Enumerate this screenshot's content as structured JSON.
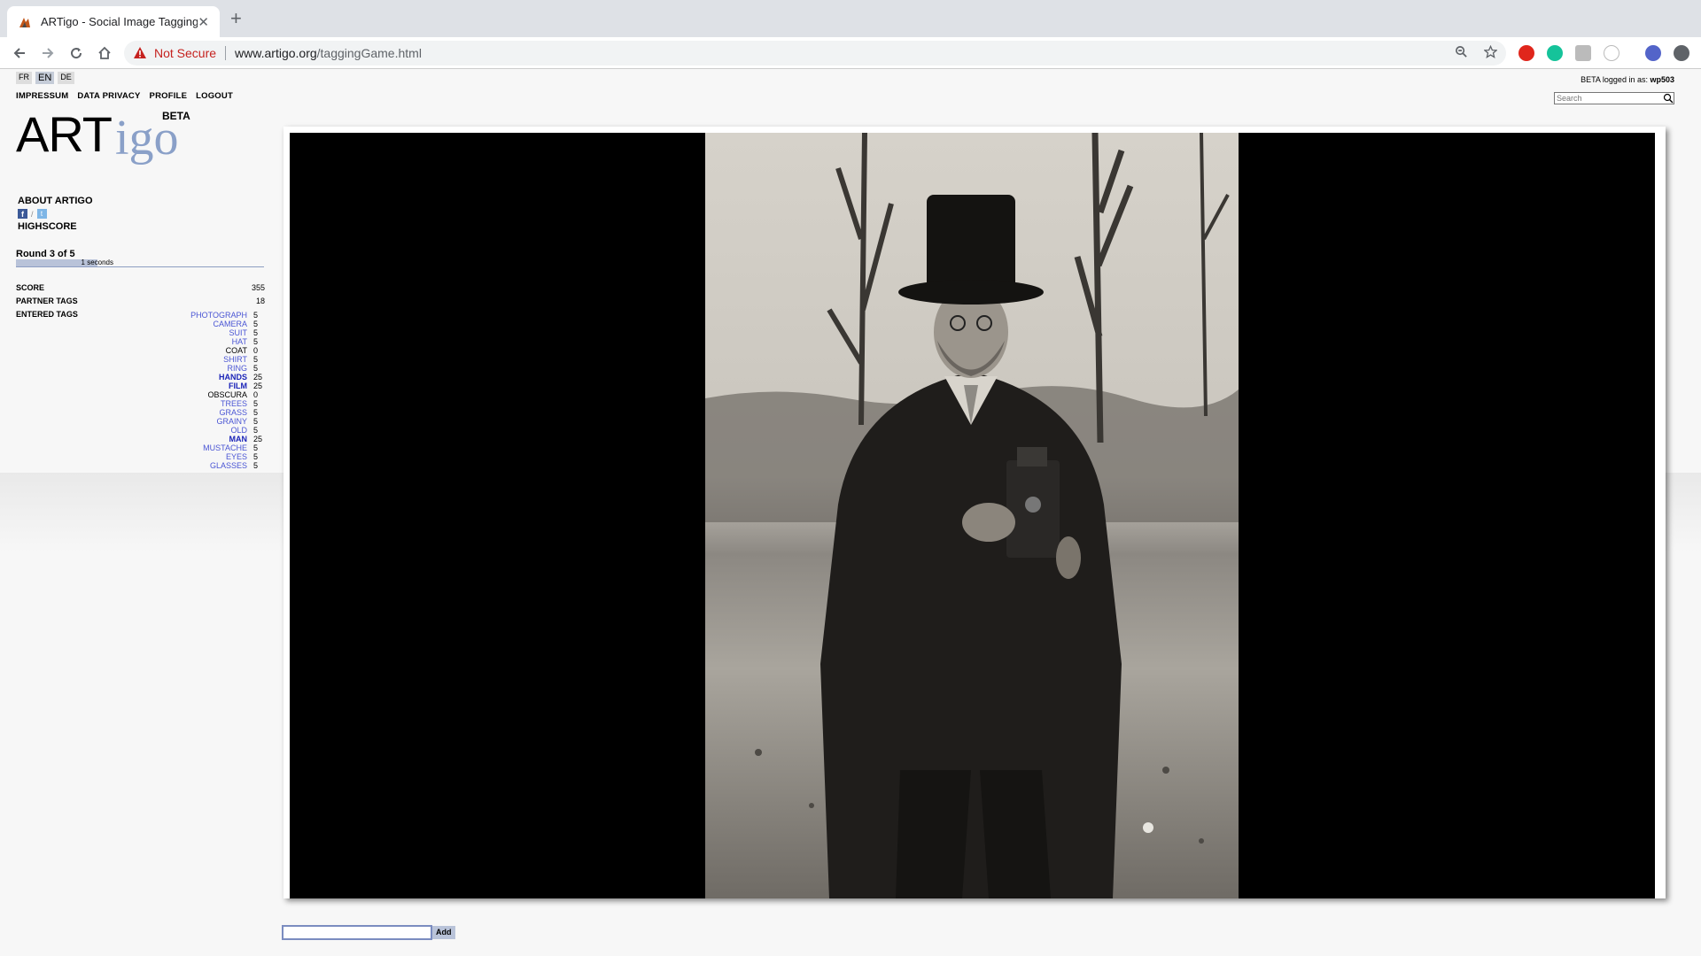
{
  "browser": {
    "tab_title": "ARTigo - Social Image Tagging",
    "new_tab": "+",
    "security_label": "Not Secure",
    "url_host": "www.artigo.org",
    "url_path": "/taggingGame.html"
  },
  "languages": [
    "FR",
    "EN",
    "DE"
  ],
  "active_language": "EN",
  "nav": {
    "impressum": "IMPRESSUM",
    "privacy": "DATA PRIVACY",
    "profile": "PROFILE",
    "logout": "LOGOUT"
  },
  "login": {
    "prefix": "BETA logged in as:",
    "user": "wp503"
  },
  "search": {
    "placeholder": "Search"
  },
  "logo": {
    "art": "ART",
    "igo": "igo",
    "beta": "BETA"
  },
  "sidebar": {
    "about": "ABOUT ARTIGO",
    "highscore": "HIGHSCORE",
    "round": "Round 3 of 5",
    "timer_text": "1 seconds",
    "timer_fraction": 0.33
  },
  "stats": {
    "score_label": "SCORE",
    "score_value": "355",
    "partner_label": "PARTNER TAGS",
    "partner_value": "18",
    "entered_label": "ENTERED TAGS"
  },
  "tags": [
    {
      "name": "PHOTOGRAPH",
      "score": "5",
      "style": "normal"
    },
    {
      "name": "CAMERA",
      "score": "5",
      "style": "normal"
    },
    {
      "name": "SUIT",
      "score": "5",
      "style": "normal"
    },
    {
      "name": "HAT",
      "score": "5",
      "style": "normal"
    },
    {
      "name": "COAT",
      "score": "0",
      "style": "zero"
    },
    {
      "name": "SHIRT",
      "score": "5",
      "style": "normal"
    },
    {
      "name": "RING",
      "score": "5",
      "style": "normal"
    },
    {
      "name": "HANDS",
      "score": "25",
      "style": "bold"
    },
    {
      "name": "FILM",
      "score": "25",
      "style": "bold"
    },
    {
      "name": "OBSCURA",
      "score": "0",
      "style": "zero"
    },
    {
      "name": "TREES",
      "score": "5",
      "style": "normal"
    },
    {
      "name": "GRASS",
      "score": "5",
      "style": "normal"
    },
    {
      "name": "GRAINY",
      "score": "5",
      "style": "normal"
    },
    {
      "name": "OLD",
      "score": "5",
      "style": "normal"
    },
    {
      "name": "MAN",
      "score": "25",
      "style": "bold"
    },
    {
      "name": "MUSTACHE",
      "score": "5",
      "style": "normal"
    },
    {
      "name": "EYES",
      "score": "5",
      "style": "normal"
    },
    {
      "name": "GLASSES",
      "score": "5",
      "style": "normal"
    }
  ],
  "input": {
    "value": "",
    "add_label": "Add"
  },
  "colors": {
    "link": "#4a55d4",
    "link_bold": "#1b24b8",
    "logo_igo": "#8aa0c8",
    "warning": "#c5221f"
  }
}
